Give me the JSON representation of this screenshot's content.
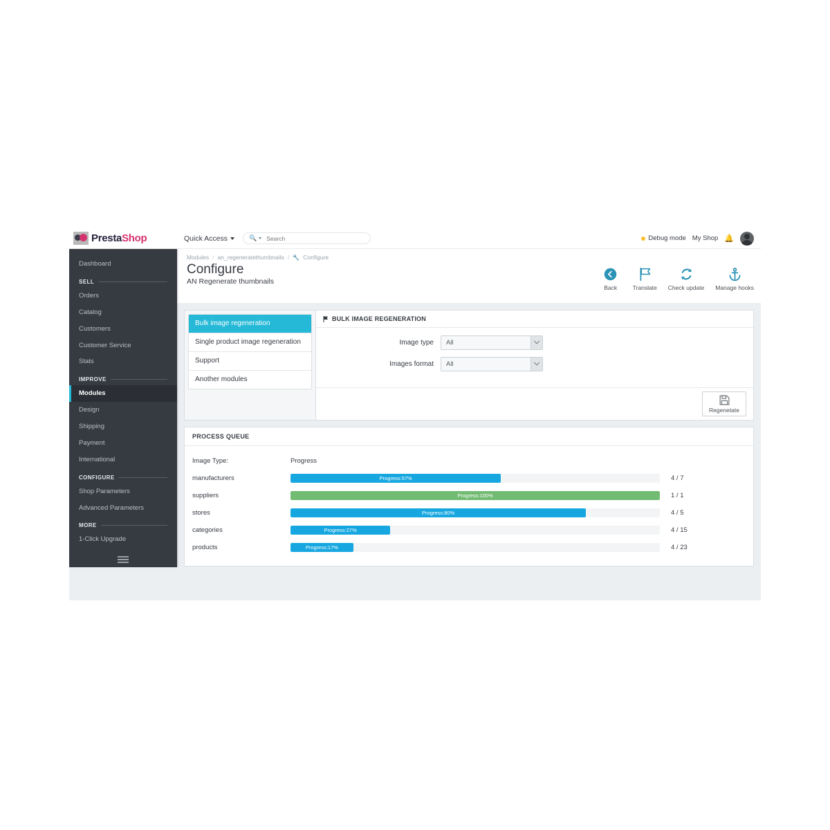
{
  "topbar": {
    "logo_presta": "Presta",
    "logo_shop": "Shop",
    "quick_access_label": "Quick Access",
    "search_placeholder": "Search",
    "search_value": "",
    "debug_mode_label": "Debug mode",
    "my_shop_label": "My Shop",
    "bell_icon": "bell-icon",
    "avatar_icon": "avatar"
  },
  "sidebar": {
    "items": [
      {
        "label": "Dashboard",
        "type": "item",
        "active": false
      },
      {
        "label": "SELL",
        "type": "section"
      },
      {
        "label": "Orders",
        "type": "item",
        "active": false
      },
      {
        "label": "Catalog",
        "type": "item",
        "active": false
      },
      {
        "label": "Customers",
        "type": "item",
        "active": false
      },
      {
        "label": "Customer Service",
        "type": "item",
        "active": false
      },
      {
        "label": "Stats",
        "type": "item",
        "active": false
      },
      {
        "label": "IMPROVE",
        "type": "section"
      },
      {
        "label": "Modules",
        "type": "item",
        "active": true
      },
      {
        "label": "Design",
        "type": "item",
        "active": false
      },
      {
        "label": "Shipping",
        "type": "item",
        "active": false
      },
      {
        "label": "Payment",
        "type": "item",
        "active": false
      },
      {
        "label": "International",
        "type": "item",
        "active": false
      },
      {
        "label": "CONFIGURE",
        "type": "section"
      },
      {
        "label": "Shop Parameters",
        "type": "item",
        "active": false
      },
      {
        "label": "Advanced Parameters",
        "type": "item",
        "active": false
      },
      {
        "label": "MORE",
        "type": "section"
      },
      {
        "label": "1-Click Upgrade",
        "type": "item",
        "active": false
      }
    ],
    "collapse_icon": "hamburger-icon"
  },
  "header": {
    "breadcrumb": [
      "Modules",
      "an_regeneratethumbnails",
      "Configure"
    ],
    "title": "Configure",
    "subtitle": "AN Regenerate thumbnails",
    "toolbar": [
      {
        "label": "Back",
        "icon": "back-arrow-icon"
      },
      {
        "label": "Translate",
        "icon": "flag-icon"
      },
      {
        "label": "Check update",
        "icon": "refresh-icon"
      },
      {
        "label": "Manage hooks",
        "icon": "anchor-icon"
      }
    ]
  },
  "tabs": [
    {
      "label": "Bulk image regeneration",
      "active": true
    },
    {
      "label": "Single product image regeneration",
      "active": false
    },
    {
      "label": "Support",
      "active": false
    },
    {
      "label": "Another modules",
      "active": false
    }
  ],
  "bulk_panel": {
    "title": "BULK IMAGE REGENERATION",
    "icon": "flag-icon",
    "fields": [
      {
        "label": "Image type",
        "value": "All"
      },
      {
        "label": "Images format",
        "value": "All"
      }
    ],
    "submit_label": "Regenetate",
    "submit_icon": "save-icon"
  },
  "process_queue": {
    "title": "PROCESS QUEUE",
    "columns": {
      "type": "Image Type:",
      "progress": "Progress"
    },
    "rows": [
      {
        "type": "manufacturers",
        "percent": 57,
        "text": "Progress:57%",
        "count": "4 / 7",
        "color": "#17a7e0"
      },
      {
        "type": "suppliers",
        "percent": 100,
        "text": "Progress:100%",
        "count": "1 / 1",
        "color": "#72bb72"
      },
      {
        "type": "stores",
        "percent": 80,
        "text": "Progress:80%",
        "count": "4 / 5",
        "color": "#17a7e0"
      },
      {
        "type": "categories",
        "percent": 27,
        "text": "Progress:27%",
        "count": "4 / 15",
        "color": "#17a7e0"
      },
      {
        "type": "products",
        "percent": 17,
        "text": "Progress:17%",
        "count": "4 / 23",
        "color": "#17a7e0"
      }
    ]
  },
  "colors": {
    "accent": "#25b9d7",
    "progress_blue": "#17a7e0",
    "progress_green": "#72bb72",
    "sidebar_bg": "#363a41",
    "brand_pink": "#d5336f"
  }
}
